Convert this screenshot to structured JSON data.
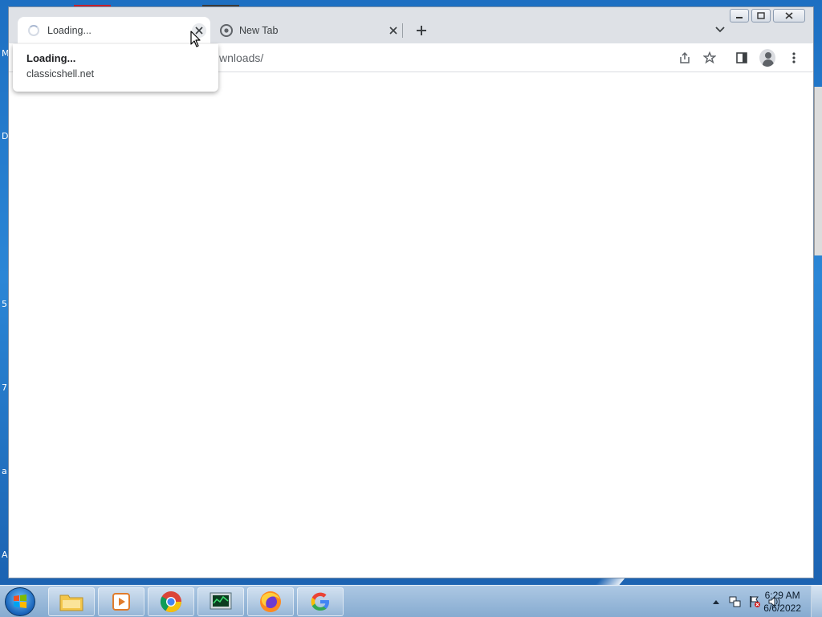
{
  "browser": {
    "tabs": [
      {
        "label": "Loading...",
        "state": "loading"
      },
      {
        "label": "New Tab",
        "state": "inactive"
      }
    ],
    "omnibox_visible_text": "wnloads/",
    "hover_card": {
      "title": "Loading...",
      "domain": "classicshell.net"
    }
  },
  "desktop": {
    "edge_letters": [
      "M",
      "D",
      "5",
      "7",
      "a",
      "A"
    ]
  },
  "taskbar": {
    "pinned": [
      "file-explorer-icon",
      "media-player-icon",
      "chrome-icon",
      "task-manager-icon",
      "firefox-icon",
      "google-icon"
    ],
    "clock_time": "6:29 AM",
    "clock_date": "6/6/2022"
  },
  "colors": {
    "tabstrip": "#dee1e6",
    "desktop_blue": "#2b86d6",
    "taskbar": "#a9c4df"
  }
}
